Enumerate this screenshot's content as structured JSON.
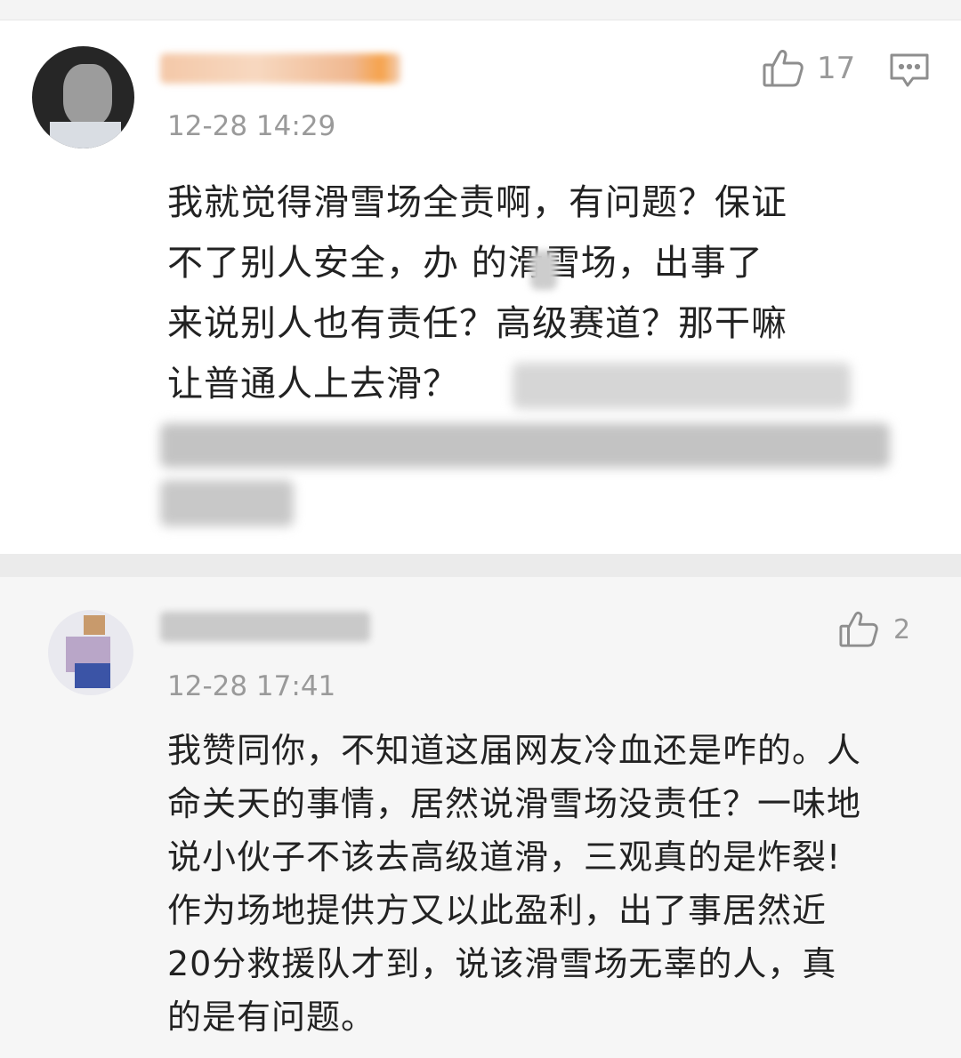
{
  "comments": [
    {
      "timestamp": "12-28 14:29",
      "like_count": "17",
      "content_lines": [
        "我就觉得滑雪场全责啊，有问题？保证",
        "不了别人安全，办 的滑雪场，出事了",
        "来说别人也有责任？高级赛道？那干嘛",
        "让普通人上去滑？"
      ]
    },
    {
      "timestamp": "12-28 17:41",
      "like_count": "2",
      "content_lines": [
        "我赞同你，不知道这届网友冷血还是咋的。人",
        "命关天的事情，居然说滑雪场没责任？一味地",
        "说小伙子不该去高级道滑，三观真的是炸裂!",
        "作为场地提供方又以此盈利，出了事居然近",
        "20分救援队才到，说该滑雪场无辜的人，真",
        "的是有问题。"
      ]
    }
  ],
  "icons": {
    "like": "thumbs-up-icon",
    "reply": "comment-icon"
  },
  "colors": {
    "text": "#222222",
    "meta": "#9a9a9a",
    "card_bg": "#ffffff",
    "reply_bg": "#f6f6f6"
  }
}
